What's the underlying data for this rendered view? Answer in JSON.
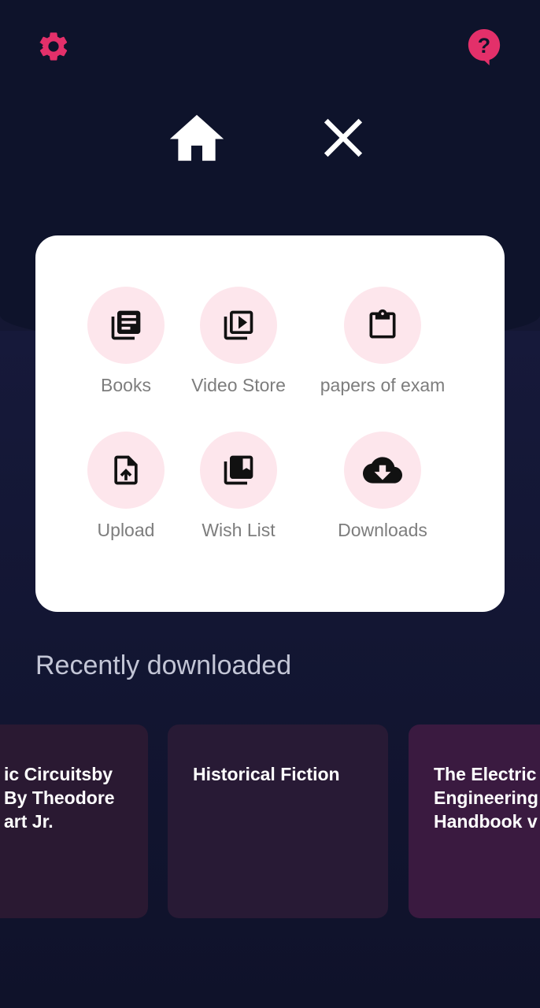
{
  "top_bar": {
    "settings_icon": "gear-icon",
    "help_icon": "help-bubble-icon",
    "accent_color": "#e3306a"
  },
  "nav": {
    "home_icon": "home-icon",
    "close_icon": "close-icon"
  },
  "menu": {
    "items": [
      {
        "label": "Books",
        "icon": "books-icon"
      },
      {
        "label": "Video Store",
        "icon": "video-library-icon"
      },
      {
        "label": "papers of exam",
        "icon": "clipboard-icon"
      },
      {
        "label": "Upload",
        "icon": "file-upload-icon"
      },
      {
        "label": "Wish List",
        "icon": "bookmark-collection-icon"
      },
      {
        "label": "Downloads",
        "icon": "cloud-download-icon"
      }
    ]
  },
  "recent": {
    "title": "Recently downloaded",
    "items": [
      {
        "title": "ic Circuitsby\nBy Theodore\nart Jr."
      },
      {
        "title": "Historical Fiction"
      },
      {
        "title": "The Electric\nEngineering\nHandbook v"
      }
    ]
  }
}
